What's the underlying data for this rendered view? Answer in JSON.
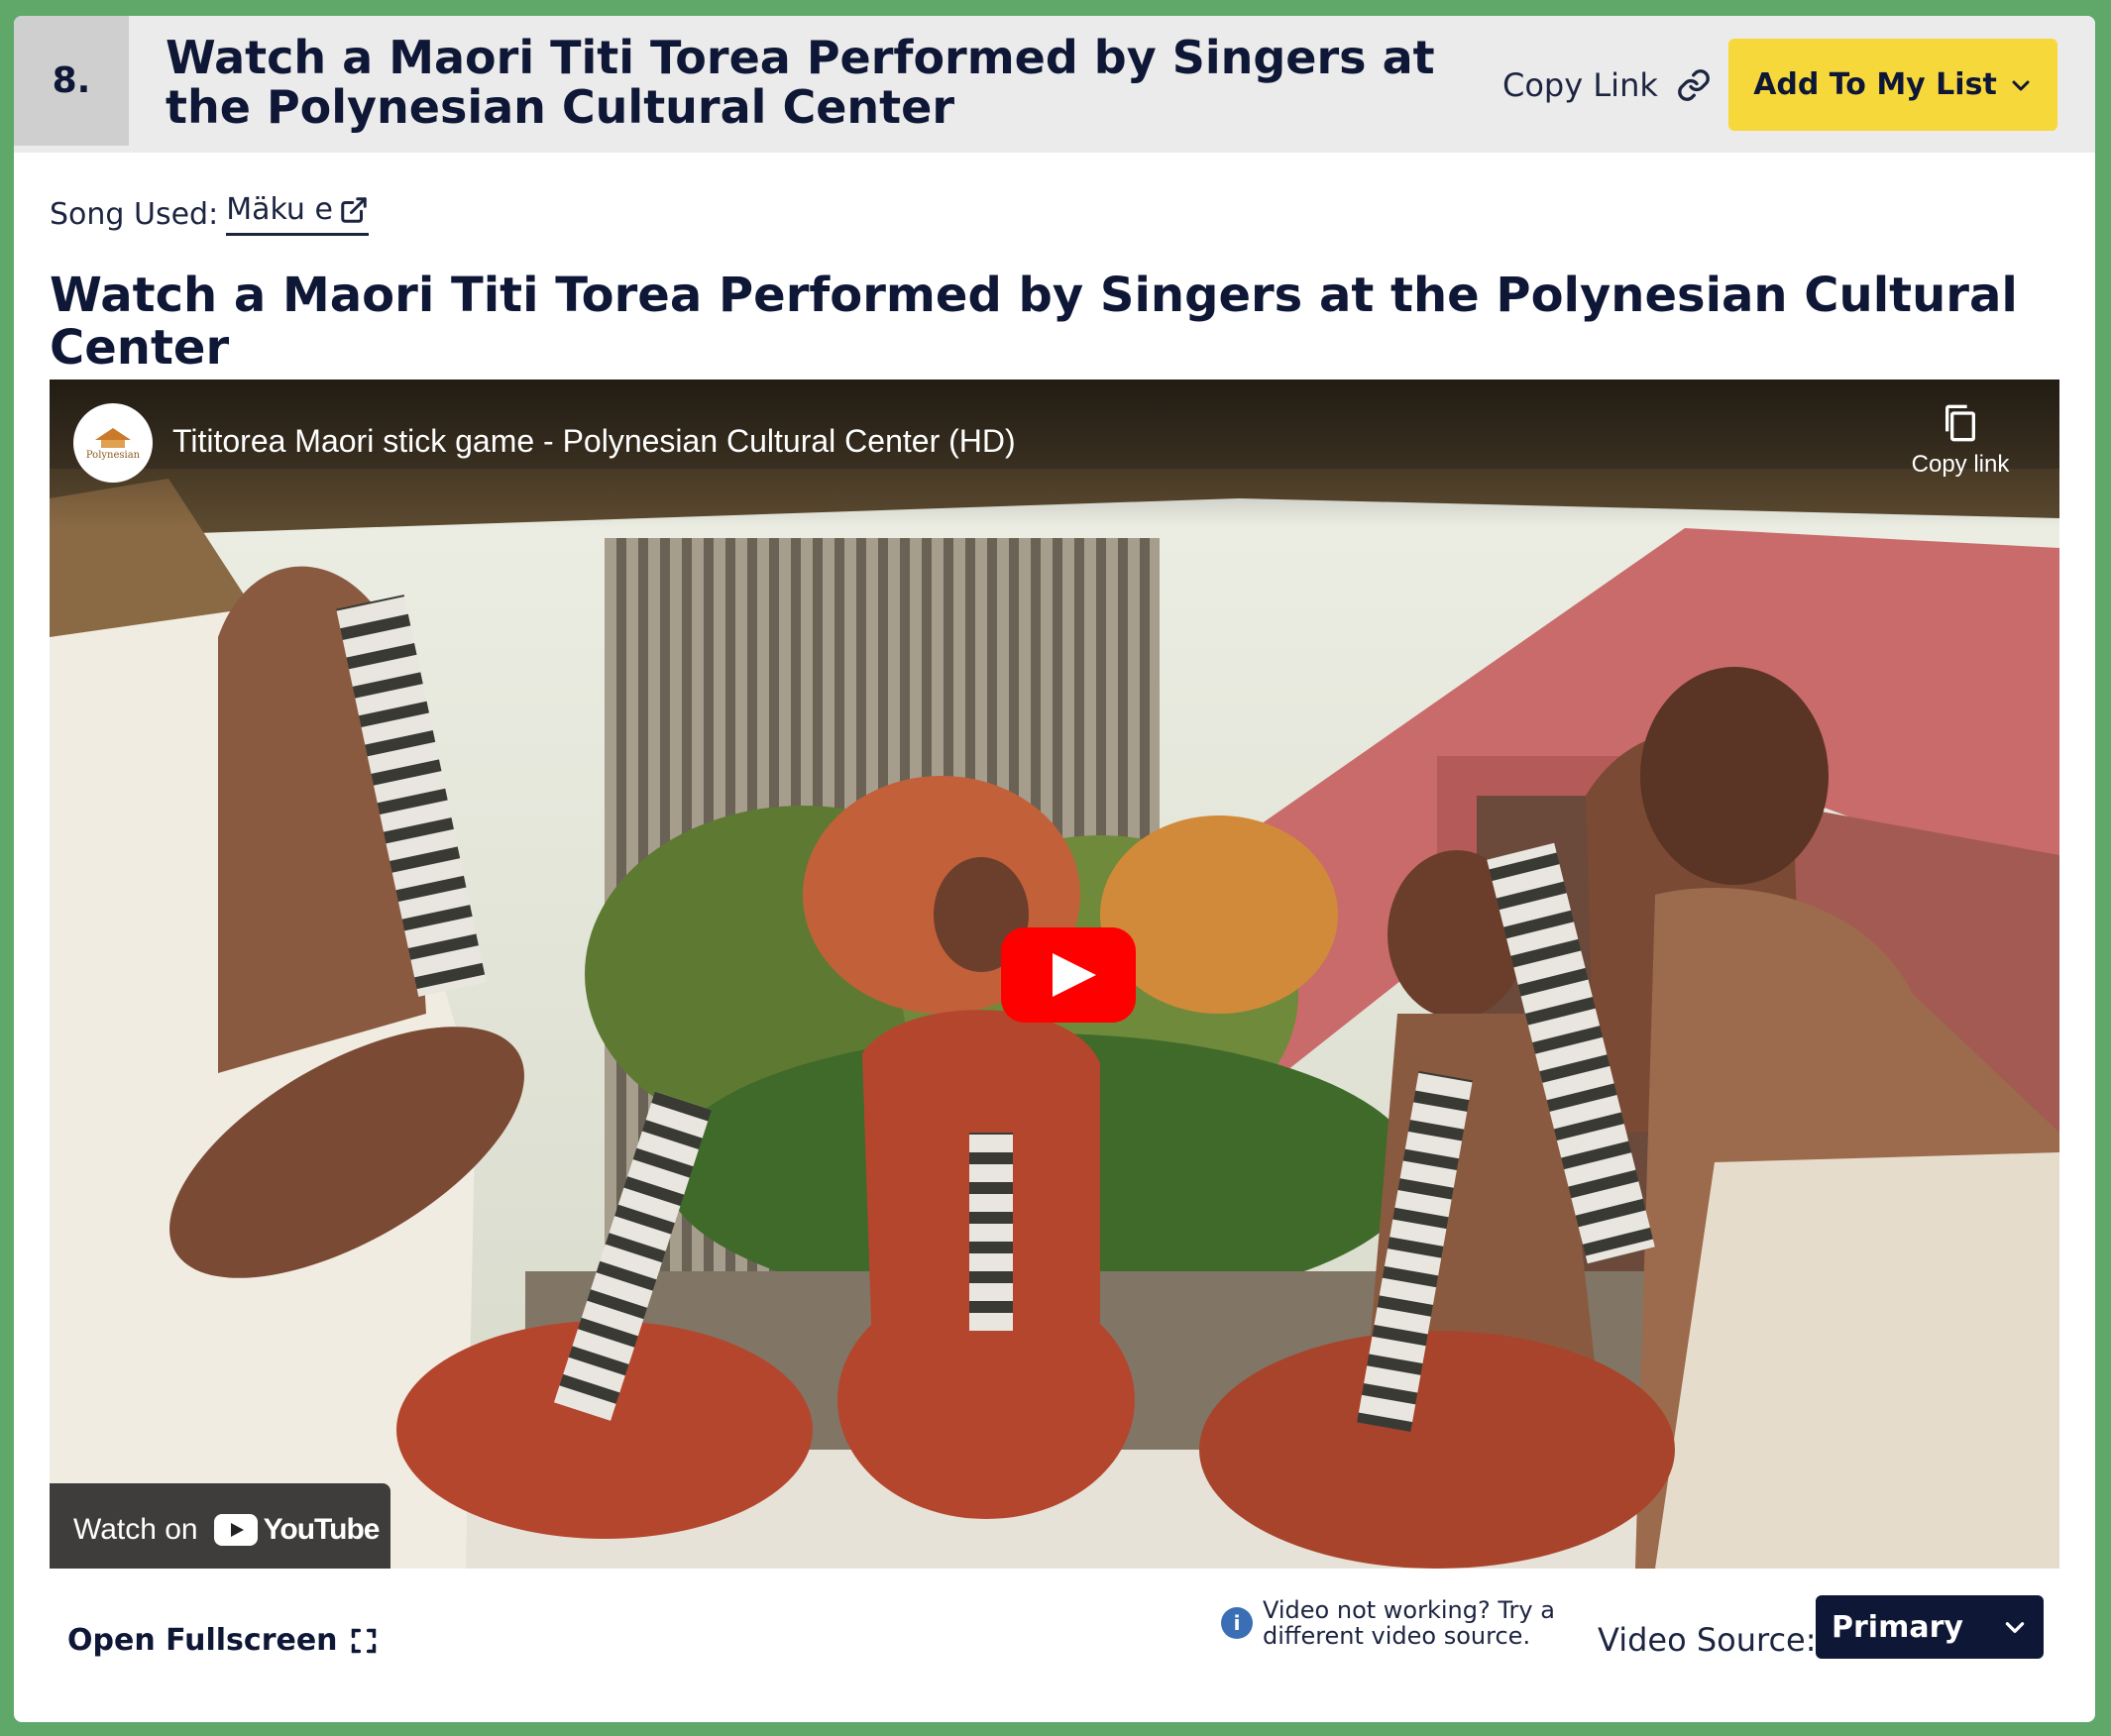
{
  "item": {
    "number": "8.",
    "header_title": "Watch a Maori Titi Torea Performed by Singers at the Polynesian Cultural Center",
    "copy_link_label": "Copy Link",
    "add_to_list_label": "Add To My List"
  },
  "song": {
    "label": "Song Used:",
    "title": "Mäku e"
  },
  "main_title": "Watch a Maori Titi Torea Performed by Singers at the Polynesian Cultural Center",
  "video": {
    "title": "Tititorea Maori stick game - Polynesian Cultural Center (HD)",
    "copy_link_label": "Copy link",
    "channel_logo_text": "Polynesian",
    "watch_on_label": "Watch on",
    "youtube_wordmark": "YouTube"
  },
  "controls": {
    "fullscreen_label": "Open Fullscreen",
    "info_text": "Video not working? Try a different video source.",
    "source_label": "Video Source:",
    "source_value": "Primary"
  },
  "colors": {
    "page_bg": "#5fa86a",
    "accent_yellow": "#f7d83b",
    "navy": "#0f1736",
    "youtube_red": "#ff0000"
  }
}
